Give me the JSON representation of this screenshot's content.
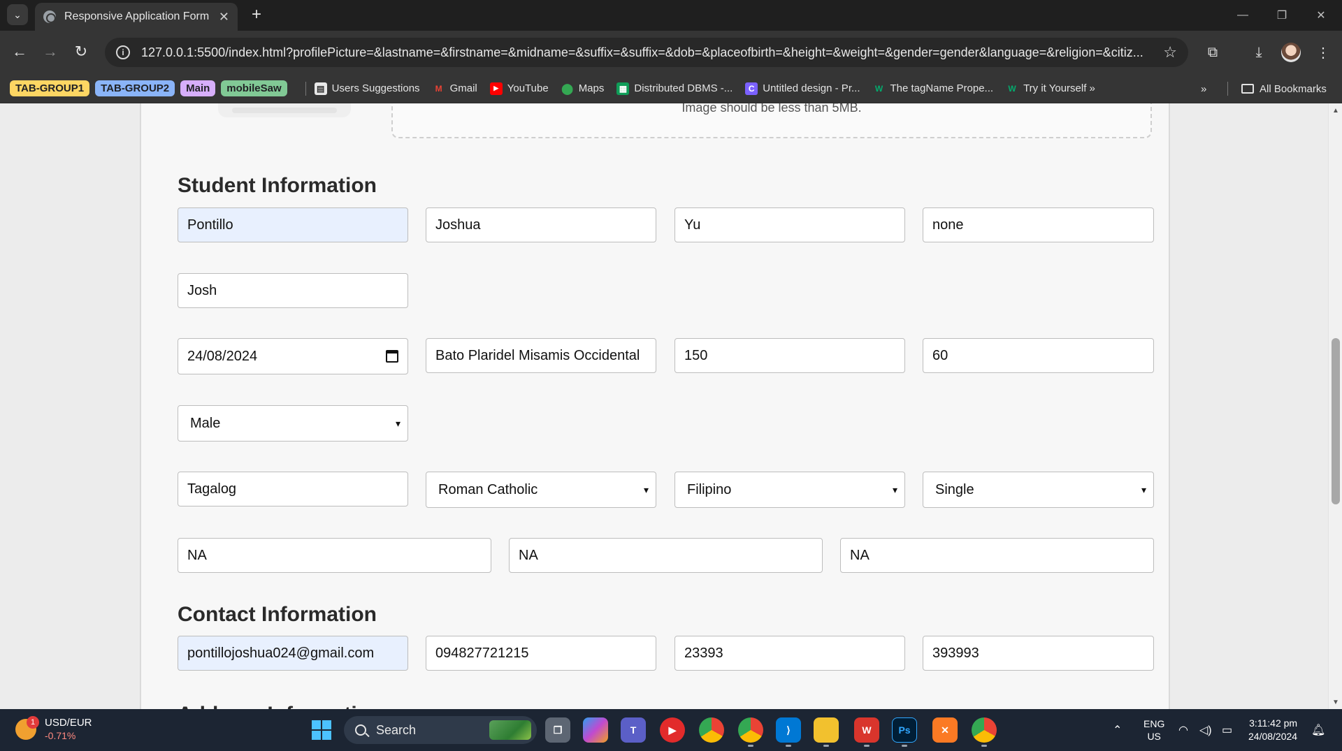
{
  "browser": {
    "tab_title": "Responsive Application Form",
    "url": "127.0.0.1:5500/index.html?profilePicture=&lastname=&firstname=&midname=&suffix=&suffix=&dob=&placeofbirth=&height=&weight=&gender=gender&language=&religion=&citiz...",
    "tab_groups": [
      {
        "label": "TAB-GROUP1",
        "color": "#fdd663",
        "text": "#202124"
      },
      {
        "label": "TAB-GROUP2",
        "color": "#8ab4f8",
        "text": "#202124"
      },
      {
        "label": "Main",
        "color": "#d7aefb",
        "text": "#202124"
      },
      {
        "label": "mobileSaw",
        "color": "#81c995",
        "text": "#202124"
      }
    ],
    "bookmarks": [
      {
        "label": "Users Suggestions",
        "icon": "page-icon"
      },
      {
        "label": "Gmail",
        "icon": "gmail-icon"
      },
      {
        "label": "YouTube",
        "icon": "youtube-icon"
      },
      {
        "label": "Maps",
        "icon": "maps-icon"
      },
      {
        "label": "Distributed DBMS -...",
        "icon": "sheet-icon"
      },
      {
        "label": "Untitled design - Pr...",
        "icon": "canva-icon"
      },
      {
        "label": "The tagName Prope...",
        "icon": "w3schools-icon"
      },
      {
        "label": "Try it Yourself »",
        "icon": "w3schools-icon"
      }
    ],
    "all_bookmarks": "All Bookmarks"
  },
  "page": {
    "upload_hint": "Image should be less than 5MB.",
    "student_section_title": "Student Information",
    "contact_section_title": "Contact Information",
    "address_section_title": "Address Information",
    "student": {
      "lastname": "Pontillo",
      "firstname": "Joshua",
      "midname": "Yu",
      "suffix": "none",
      "nickname": "Josh",
      "dob": "24/08/2024",
      "placeofbirth": "Bato Plaridel Misamis Occidental",
      "height": "150",
      "weight": "60",
      "gender": "Male",
      "language": "Tagalog",
      "religion": "Roman Catholic",
      "citizenship": "Filipino",
      "civil_status": "Single",
      "extra1": "NA",
      "extra2": "NA",
      "extra3": "NA"
    },
    "contact": {
      "email": "pontillojoshua024@gmail.com",
      "mobile": "094827721215",
      "field3": "23393",
      "field4": "393993"
    }
  },
  "taskbar": {
    "widget_label": "USD/EUR",
    "widget_change": "-0.71%",
    "widget_badge": "1",
    "search_label": "Search",
    "lang_line1": "ENG",
    "lang_line2": "US",
    "time": "3:11:42 pm",
    "date": "24/08/2024"
  }
}
